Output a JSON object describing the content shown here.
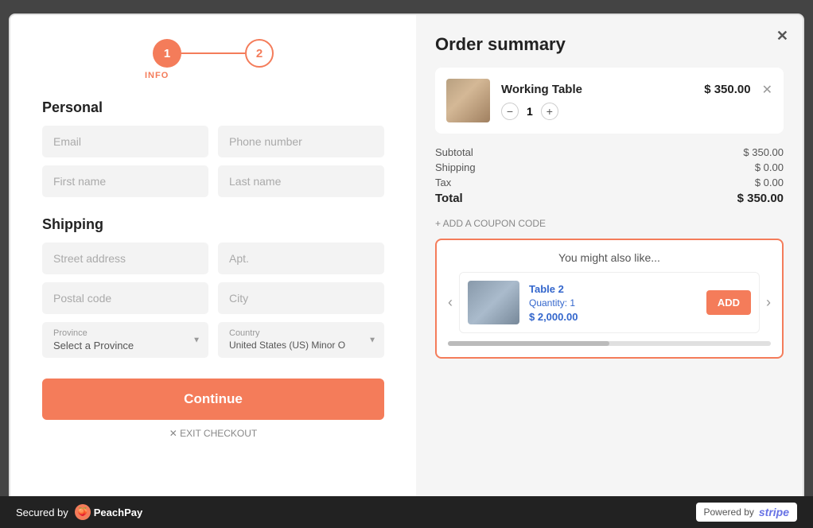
{
  "modal": {
    "close_label": "✕"
  },
  "stepper": {
    "step1": {
      "number": "1",
      "label": "INFO"
    },
    "step2": {
      "number": "2",
      "label": ""
    }
  },
  "personal": {
    "section_title": "Personal",
    "email_placeholder": "Email",
    "phone_placeholder": "Phone number",
    "firstname_placeholder": "First name",
    "lastname_placeholder": "Last name"
  },
  "shipping": {
    "section_title": "Shipping",
    "street_placeholder": "Street address",
    "apt_placeholder": "Apt.",
    "postal_placeholder": "Postal code",
    "city_placeholder": "City",
    "province_label": "Province",
    "province_value": "Select a Province",
    "country_label": "Country",
    "country_value": "United States (US) Minor O"
  },
  "continue_button": "Continue",
  "exit_link": "✕ EXIT CHECKOUT",
  "order_summary": {
    "title": "Order summary",
    "product": {
      "name": "Working Table",
      "price": "$ 350.00",
      "quantity": "1"
    },
    "subtotal_label": "Subtotal",
    "subtotal_value": "$ 350.00",
    "shipping_label": "Shipping",
    "shipping_value": "$ 0.00",
    "tax_label": "Tax",
    "tax_value": "$ 0.00",
    "total_label": "Total",
    "total_value": "$ 350.00",
    "coupon_label": "+ ADD A COUPON CODE"
  },
  "recommendation": {
    "title": "You might also like...",
    "item": {
      "name": "Table 2",
      "quantity_label": "Quantity: 1",
      "price": "$ 2,000.00",
      "add_label": "ADD"
    }
  },
  "footer": {
    "secured_by": "Secured by",
    "brand_name": "PeachPay",
    "powered_by": "Powered by",
    "stripe": "stripe"
  }
}
